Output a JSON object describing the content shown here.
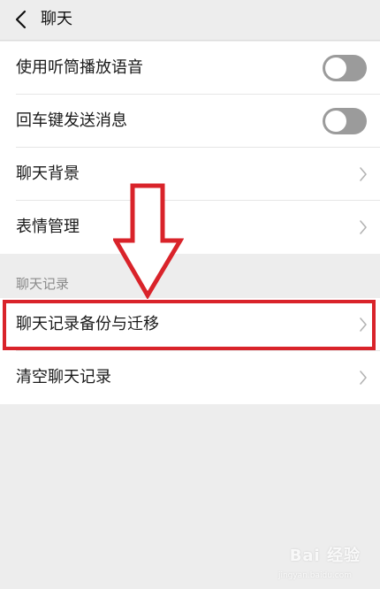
{
  "header": {
    "title": "聊天",
    "back_icon": "chevron-left-icon"
  },
  "settings": {
    "rows": [
      {
        "label": "使用听筒播放语音",
        "control": "toggle",
        "on": false
      },
      {
        "label": "回车键发送消息",
        "control": "toggle",
        "on": false
      },
      {
        "label": "聊天背景",
        "control": "chevron"
      },
      {
        "label": "表情管理",
        "control": "chevron"
      }
    ]
  },
  "history_section": {
    "label": "聊天记录",
    "rows": [
      {
        "label": "聊天记录备份与迁移",
        "control": "chevron"
      },
      {
        "label": "清空聊天记录",
        "control": "chevron"
      }
    ]
  },
  "annotation": {
    "color": "#d9232a"
  },
  "watermark": {
    "text": "Bai 经验",
    "sub": "jingyan.baidu.com"
  },
  "colors": {
    "background": "#ededed",
    "card": "#ffffff",
    "toggle_off": "#9b9b9b",
    "highlight": "#d9232a"
  }
}
